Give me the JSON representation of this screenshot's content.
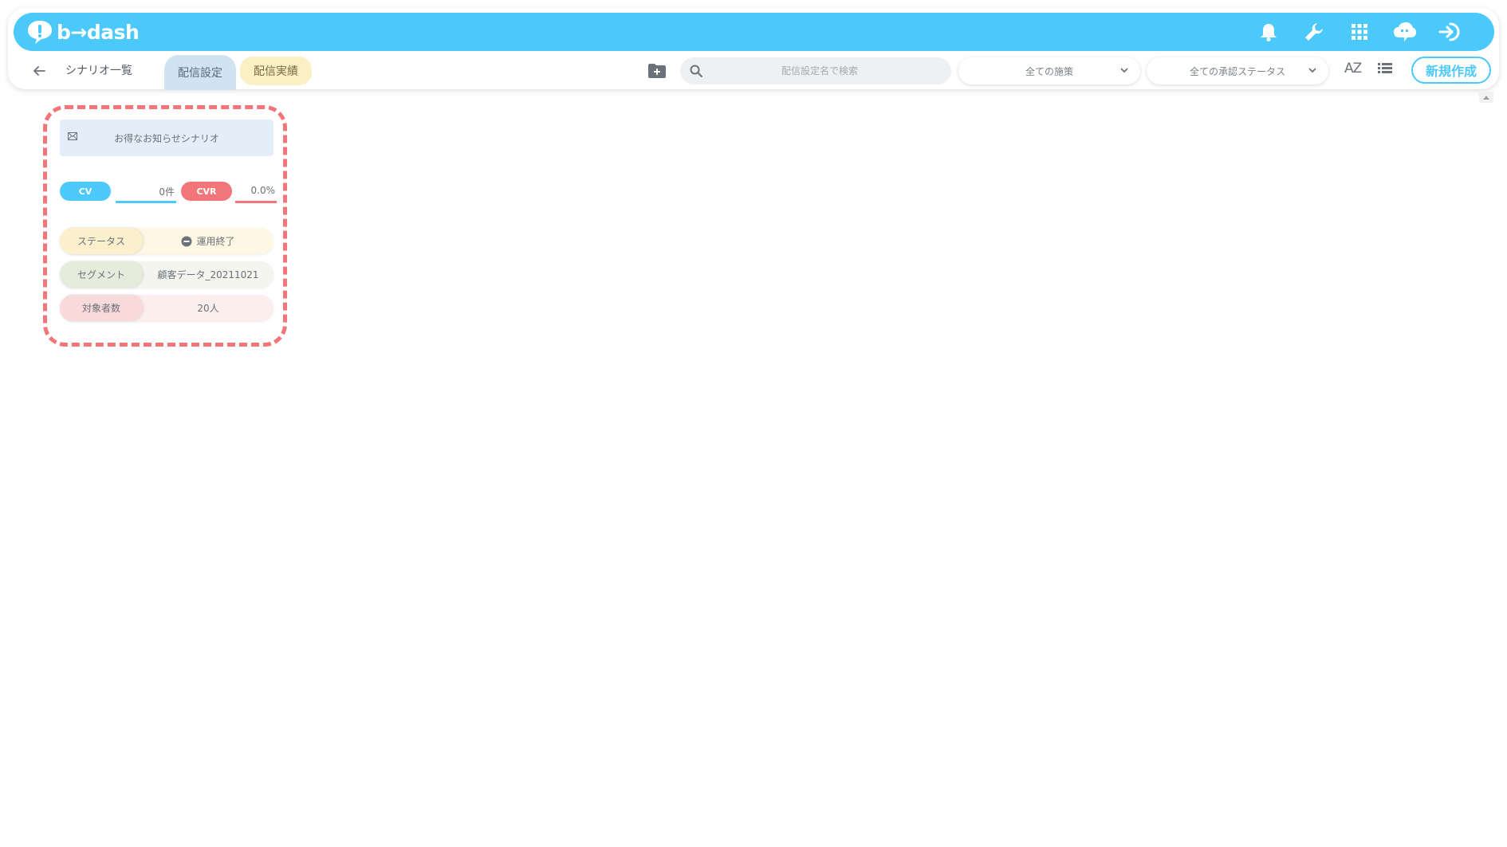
{
  "app": {
    "logo_text": "b→dash",
    "brand_color": "#4bc9fa"
  },
  "topbar": {
    "icons": [
      "bell-icon",
      "wrench-icon",
      "apps-grid-icon",
      "cloud-chat-icon",
      "logout-icon"
    ]
  },
  "subbar": {
    "back_icon": "arrow-left-icon",
    "breadcrumb": "シナリオ一覧",
    "tabs": [
      {
        "label": "配信設定",
        "active": true
      },
      {
        "label": "配信実績",
        "active": false
      }
    ],
    "folder_icon": "folder-add-icon",
    "search": {
      "placeholder": "配信設定名で検索",
      "value": ""
    },
    "filters": [
      {
        "selected": "全ての施策"
      },
      {
        "selected": "全ての承認ステータス"
      }
    ],
    "sort_label": "AZ",
    "list_icon": "list-view-icon",
    "new_button": "新規作成"
  },
  "card": {
    "title": "お得なお知らせシナリオ",
    "title_icon": "mail-icon",
    "cv_label": "CV",
    "cv_value": "0件",
    "cvr_label": "CVR",
    "cvr_value": "0.0%",
    "rows": [
      {
        "key": "ステータス",
        "value": "運用終了",
        "icon": "minus-circle-icon"
      },
      {
        "key": "セグメント",
        "value": "顧客データ_20211021"
      },
      {
        "key": "対象者数",
        "value": "20人"
      }
    ],
    "highlight_color": "#f27679"
  }
}
